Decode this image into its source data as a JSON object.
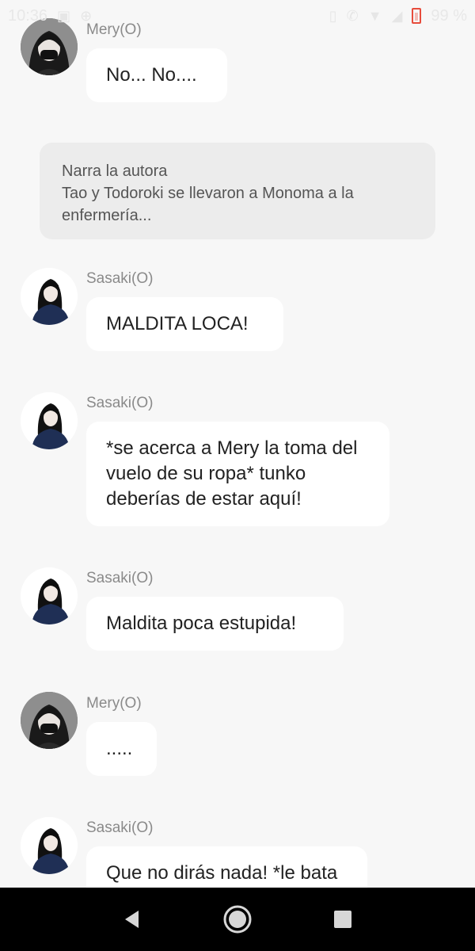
{
  "status_bar": {
    "time": "10:36",
    "battery": "99 %"
  },
  "messages": [
    {
      "sender": "Mery(O)",
      "avatar": "mery-avatar",
      "text": "No... No...."
    },
    {
      "narration_title": "Narra la autora",
      "narration_text": "Tao y Todoroki se llevaron a Monoma a la enfermería..."
    },
    {
      "sender": "Sasaki(O)",
      "avatar": "sasaki-avatar",
      "text": "MALDITA LOCA!"
    },
    {
      "sender": "Sasaki(O)",
      "avatar": "sasaki-avatar",
      "text": "*se acerca a Mery la toma del vuelo de su ropa* tunko deberías de estar aquí!"
    },
    {
      "sender": "Sasaki(O)",
      "avatar": "sasaki-avatar",
      "text": "Maldita poca estupida!"
    },
    {
      "sender": "Mery(O)",
      "avatar": "mery-avatar",
      "text": "....."
    },
    {
      "sender": "Sasaki(O)",
      "avatar": "sasaki-avatar",
      "text": "Que no dirás nada! *le bata"
    }
  ],
  "nav_bar": {
    "back": "back-icon",
    "home": "home-icon",
    "recents": "recents-icon"
  },
  "colors": {
    "background": "#f7f7f7",
    "bubble": "#ffffff",
    "narration": "#ececec",
    "sender_text": "#8a8a8a",
    "battery": "#e74c3c"
  }
}
